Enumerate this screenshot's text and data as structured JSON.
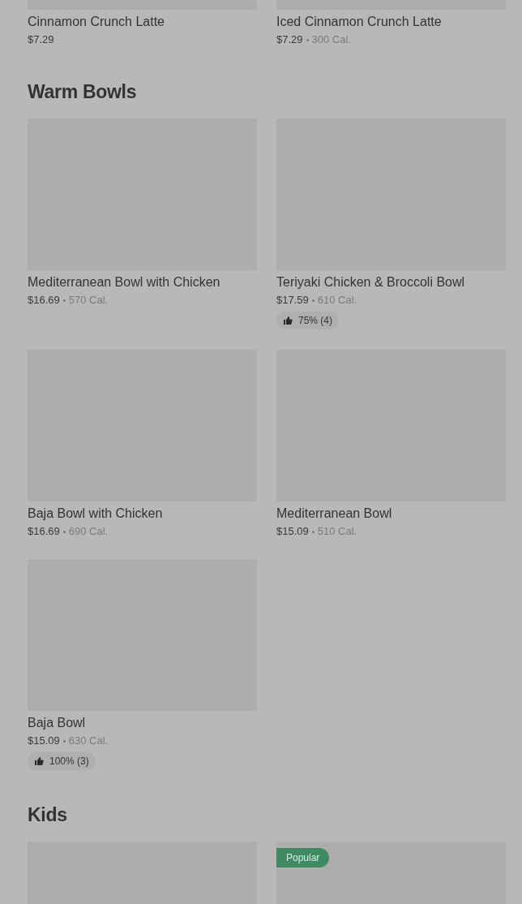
{
  "sections": [
    {
      "items": [
        {
          "kind": "picture",
          "name": "Cinnamon Crunch Latte",
          "price": "$7.29"
        },
        {
          "kind": "picture",
          "name": "Iced Cinnamon Crunch Latte",
          "price": "$7.29",
          "calories": "300 Cal."
        }
      ]
    },
    {
      "title": "Warm Bowls",
      "items": [
        {
          "kind": "picture",
          "name": "Mediterranean Bowl with Chicken",
          "price": "$16.69",
          "calories": "570 Cal."
        },
        {
          "kind": "picture",
          "name": "Teriyaki Chicken & Broccoli Bowl",
          "price": "$17.59",
          "calories": "610 Cal.",
          "rating": "75% (4)"
        },
        {
          "kind": "picture",
          "name": "Baja Bowl with Chicken",
          "price": "$16.69",
          "calories": "690 Cal."
        },
        {
          "kind": "picture",
          "name": "Mediterranean Bowl",
          "price": "$15.09",
          "calories": "510 Cal."
        },
        {
          "kind": "picture",
          "name": "Baja Bowl",
          "price": "$15.09",
          "calories": "630 Cal.",
          "rating": "100% (3)"
        }
      ]
    },
    {
      "title": "Kids",
      "items": [
        {
          "kind": "picture"
        },
        {
          "kind": "picture",
          "badge": "Popular"
        }
      ]
    }
  ]
}
